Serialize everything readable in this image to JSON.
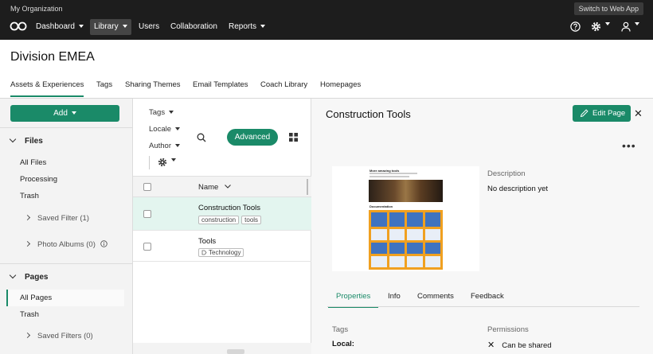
{
  "topbar": {
    "org": "My Organization",
    "switch_label": "Switch to Web App",
    "nav": [
      "Dashboard",
      "Library",
      "Users",
      "Collaboration",
      "Reports"
    ]
  },
  "page": {
    "title": "Division EMEA",
    "tabs": [
      "Assets & Experiences",
      "Tags",
      "Sharing Themes",
      "Email Templates",
      "Coach Library",
      "Homepages"
    ]
  },
  "sidebar": {
    "add_label": "Add",
    "files_heading": "Files",
    "files_items": [
      "All Files",
      "Processing",
      "Trash"
    ],
    "saved_filter": "Saved Filter (1)",
    "photo_albums": "Photo Albums (0)",
    "pages_heading": "Pages",
    "pages_items": [
      "All Pages",
      "Trash"
    ],
    "saved_filters": "Saved Filters (0)"
  },
  "list": {
    "filters": [
      "Tags",
      "Locale",
      "Author"
    ],
    "advanced_label": "Advanced",
    "column_name": "Name",
    "rows": [
      {
        "name": "Construction Tools",
        "tags": [
          "construction",
          "tools"
        ]
      },
      {
        "name": "Tools",
        "tags": [
          "Technology"
        ]
      }
    ]
  },
  "detail": {
    "title": "Construction Tools",
    "edit_label": "Edit Page",
    "description_label": "Description",
    "description_value": "No description yet",
    "tabs": [
      "Properties",
      "Info",
      "Comments",
      "Feedback"
    ],
    "tags_label": "Tags",
    "local_label": "Local:",
    "permissions_label": "Permissions",
    "permission_value": "Can be shared",
    "thumb_heading": "More amazing tools",
    "thumb_section": "Documentation"
  },
  "colors": {
    "accent": "#1a8a68",
    "topbar": "#1d1d1d",
    "selected_row": "#e3f5ef"
  }
}
